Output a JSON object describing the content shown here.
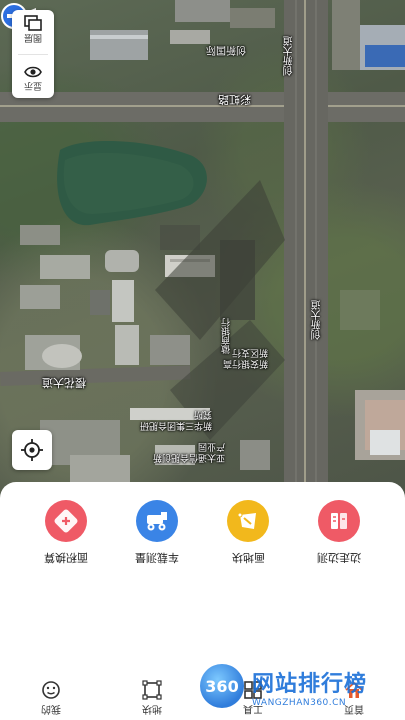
{
  "map": {
    "labels": {
      "top_road_name": "彩虹路",
      "top_area": "创新国际",
      "vertical_road_top": "创新大道",
      "vertical_road_right": "创新大道",
      "left_road": "樱花大道",
      "bank": "徽商银行",
      "bank_branch": "新安银行高新区支行",
      "institute": "新华三集团合肥研究所",
      "industry_park": "亚太通信合肥创新产业园"
    },
    "controls": {
      "layers_label": "图层",
      "display_label": "显示"
    }
  },
  "tools": [
    {
      "label": "面积换算",
      "color": "#ef5a66",
      "icon": "area-convert-icon"
    },
    {
      "label": "车载测量",
      "color": "#3a84e6",
      "icon": "vehicle-measure-icon"
    },
    {
      "label": "画地块",
      "color": "#f2b81c",
      "icon": "draw-plot-icon"
    },
    {
      "label": "边走边测",
      "color": "#ef5a66",
      "icon": "walk-measure-icon"
    }
  ],
  "tabs": [
    {
      "label": "我的",
      "icon": "profile-face-icon"
    },
    {
      "label": "地块",
      "icon": "plot-icon"
    },
    {
      "label": "工具",
      "icon": "tools-grid-icon"
    },
    {
      "label": "首页",
      "icon": "home-icon"
    }
  ],
  "watermark": {
    "badge": "360",
    "title": "网站排行榜",
    "url": "WANGZHAN360.CN"
  }
}
